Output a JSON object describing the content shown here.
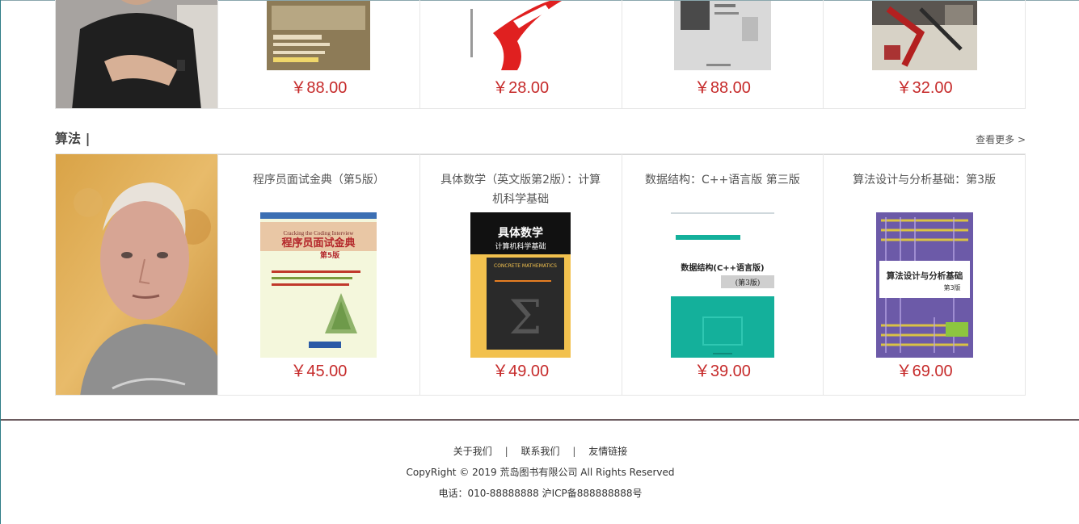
{
  "top_row": {
    "prices": [
      "￥88.00",
      "￥28.00",
      "￥88.00",
      "￥32.00"
    ]
  },
  "algorithms": {
    "section_title": "算法 |",
    "more_label": "查看更多 >",
    "books": [
      {
        "title": "程序员面试金典（第5版）",
        "price": "￥45.00",
        "cover_title": "程序员面试金典",
        "cover_sub": "Cracking the Coding Interview",
        "cover_edition": "第5版",
        "cover_color": "#f3f6d6",
        "accent": "#c0392b"
      },
      {
        "title": "具体数学（英文版第2版）：计算机科学基础",
        "price": "￥49.00",
        "cover_title": "具体数学",
        "cover_sub": "计算机科学基础",
        "cover_en": "CONCRETE MATHEMATICS",
        "cover_color": "#111111",
        "accent": "#f2c14e"
      },
      {
        "title": "数据结构：C++语言版 第三版",
        "price": "￥39.00",
        "cover_title": "数据结构(C++语言版)",
        "cover_edition": "(第3版)",
        "cover_color": "#ffffff",
        "accent": "#14b09b"
      },
      {
        "title": "算法设计与分析基础：第3版",
        "price": "￥69.00",
        "cover_title": "算法设计与分析基础",
        "cover_edition": "第3版",
        "cover_color": "#6c5aa8",
        "accent": "#d9c244"
      }
    ]
  },
  "footer": {
    "links": [
      "关于我们",
      "联系我们",
      "友情链接"
    ],
    "separator": "|",
    "copyright": "CopyRight © 2019 荒岛图书有限公司 All Rights Reserved",
    "contact": "电话：010-88888888 沪ICP备888888888号"
  }
}
